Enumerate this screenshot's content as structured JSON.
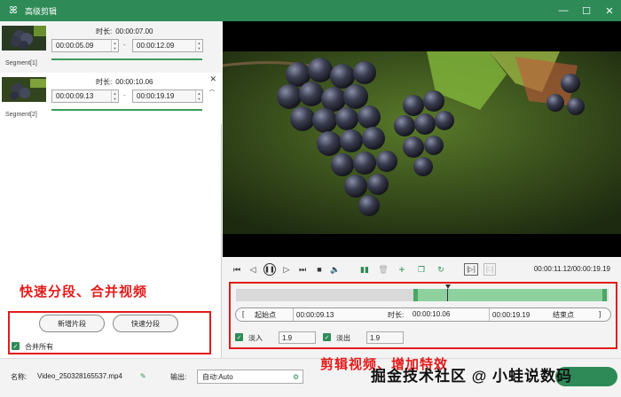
{
  "window": {
    "title": "高级剪辑",
    "logo_glyph": "ꕤ",
    "minimize": "—",
    "maximize": "☐",
    "close": "✕"
  },
  "segments": [
    {
      "label": "Segment[1]",
      "duration_label": "时长:",
      "duration": "00:00:07.00",
      "start": "00:00:05.09",
      "end": "00:00:12.09"
    },
    {
      "label": "Segment[2]",
      "duration_label": "时长:",
      "duration": "00:00:10.06",
      "start": "00:00:09.13",
      "end": "00:00:19.19"
    }
  ],
  "annotation_left": "快速分段、合并视频",
  "annotation_right": "剪辑视频、增加特效",
  "buttons": {
    "add_segment": "新增片段",
    "quick_split": "快速分段",
    "merge_all": "合并所有"
  },
  "player": {
    "time_readout": "00:00:11.12/00:00:19.19"
  },
  "trim": {
    "bracket_open": "[",
    "start_label": "起始点",
    "start_value": "00:00:09.13",
    "duration_label": "时长:",
    "duration_value": "00:00:10.06",
    "end_value": "00:00:19.19",
    "end_label": "结束点",
    "bracket_close": "]"
  },
  "fade": {
    "fade_in_label": "淡入",
    "fade_in_value": "1.9",
    "fade_out_label": "淡出",
    "fade_out_value": "1.9"
  },
  "bottom": {
    "name_label": "名称:",
    "file_name": "Video_250328165537.mp4",
    "output_label": "输出:",
    "output_value": "自动:Auto"
  },
  "watermark": "掘金技术社区 @ 小蛙说数码",
  "colors": {
    "accent": "#2e8b57",
    "annotation": "#e21b1b"
  }
}
